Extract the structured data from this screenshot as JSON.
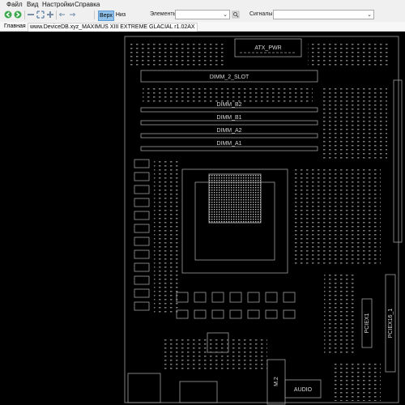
{
  "menu": [
    "Файл",
    "Вид",
    "Настройки",
    "Справка"
  ],
  "toolbar": {
    "icons": [
      "back-icon",
      "forward-icon",
      "zoom-out-icon",
      "fit-icon",
      "zoom-in-icon",
      "rotate-left-icon",
      "rotate-right-icon"
    ],
    "buttons": {
      "side_top": "Верх",
      "side_bottom": "Низ"
    },
    "components_label": "Элементы",
    "components_value": "",
    "signals_label": "Сигналы",
    "signals_value": ""
  },
  "tabs": [
    {
      "label": "Главная",
      "active": false
    },
    {
      "label": "www.DeviceDB.xyz_MAXIMUS XIII EXTREME GLACIAL r1.02AX",
      "active": true
    }
  ],
  "board": {
    "labels": {
      "atx_pwr": "ATX_PWR",
      "dimm_slot": "DIMM_2_SLOT",
      "dimm_b2": "DIMM_B2",
      "dimm_b1": "DIMM_B1",
      "dimm_a2": "DIMM_A2",
      "dimm_a1": "DIMM_A1",
      "pciex16_1": "PCIEX16_1",
      "pciex1": "PCIEX1",
      "m2": "M.2",
      "audio": "AUDIO"
    },
    "colors": {
      "background": "#000000",
      "outline": "#b8b8b8",
      "text": "#d8d8d8"
    }
  }
}
